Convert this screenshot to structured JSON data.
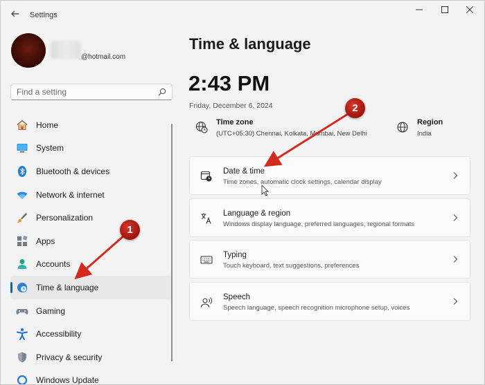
{
  "window": {
    "title": "Settings",
    "controls": {
      "minimize": "–",
      "maximize": "☐",
      "close": "✕"
    }
  },
  "account": {
    "email": "@hotmail.com"
  },
  "search": {
    "placeholder": "Find a setting"
  },
  "nav": {
    "items": [
      {
        "label": "Home",
        "icon": "home-icon"
      },
      {
        "label": "System",
        "icon": "monitor-icon"
      },
      {
        "label": "Bluetooth & devices",
        "icon": "bluetooth-icon"
      },
      {
        "label": "Network & internet",
        "icon": "wifi-icon"
      },
      {
        "label": "Personalization",
        "icon": "brush-icon"
      },
      {
        "label": "Apps",
        "icon": "apps-icon"
      },
      {
        "label": "Accounts",
        "icon": "person-icon"
      },
      {
        "label": "Time & language",
        "icon": "globe-clock-icon",
        "active": true
      },
      {
        "label": "Gaming",
        "icon": "gamepad-icon"
      },
      {
        "label": "Accessibility",
        "icon": "accessibility-icon"
      },
      {
        "label": "Privacy & security",
        "icon": "shield-icon"
      },
      {
        "label": "Windows Update",
        "icon": "update-icon"
      }
    ]
  },
  "main": {
    "title": "Time & language",
    "time": "2:43 PM",
    "date": "Friday, December 6, 2024",
    "timezone": {
      "title": "Time zone",
      "value": "(UTC+05:30) Chennai, Kolkata, Mumbai, New Delhi"
    },
    "region": {
      "title": "Region",
      "value": "India"
    },
    "cards": [
      {
        "title": "Date & time",
        "subtitle": "Time zones, automatic clock settings, calendar display",
        "icon": "calendar-clock-icon"
      },
      {
        "title": "Language & region",
        "subtitle": "Windows display language, preferred languages, regional formats",
        "icon": "language-icon"
      },
      {
        "title": "Typing",
        "subtitle": "Touch keyboard, text suggestions, preferences",
        "icon": "keyboard-icon"
      },
      {
        "title": "Speech",
        "subtitle": "Speech language, speech recognition microphone setup, voices",
        "icon": "speech-icon"
      }
    ]
  },
  "annotations": {
    "badge_1": "1",
    "badge_2": "2",
    "arrow_color": "#d42a1e"
  },
  "colors": {
    "accent": "#0067c0",
    "background": "#f3f3f3",
    "card": "#fbfbfb"
  }
}
